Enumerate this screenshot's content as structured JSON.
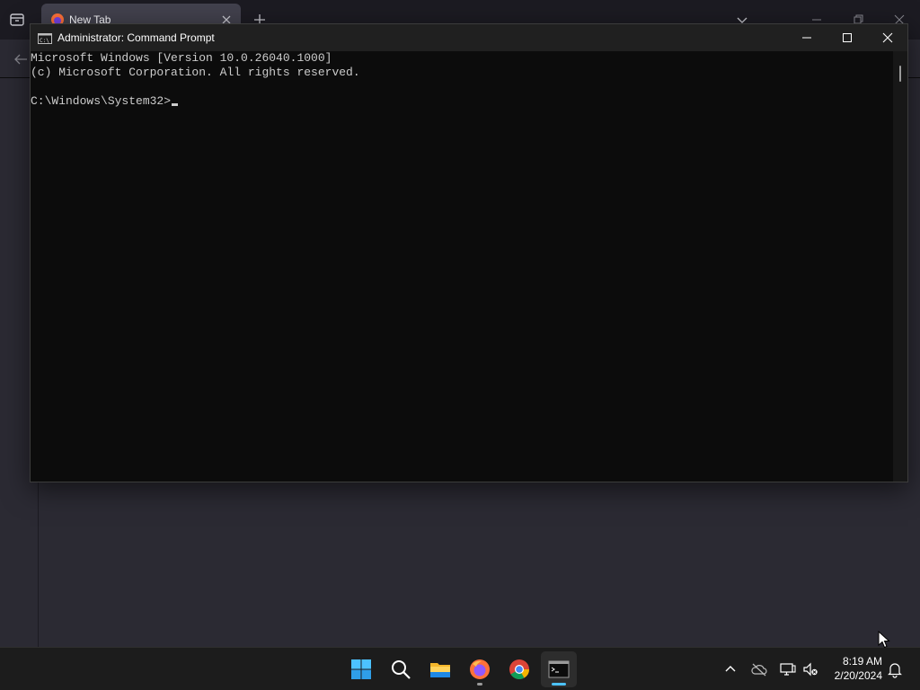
{
  "browser": {
    "tab_title": "New Tab"
  },
  "cmd": {
    "title": "Administrator: Command Prompt",
    "lines": [
      "Microsoft Windows [Version 10.0.26040.1000]",
      "(c) Microsoft Corporation. All rights reserved.",
      "",
      "C:\\Windows\\System32>"
    ]
  },
  "taskbar": {
    "apps": [
      {
        "name": "start",
        "icon": "windows-start-icon"
      },
      {
        "name": "search",
        "icon": "search-icon"
      },
      {
        "name": "file-explorer",
        "icon": "folder-icon"
      },
      {
        "name": "firefox",
        "icon": "firefox-icon"
      },
      {
        "name": "chrome",
        "icon": "chrome-icon"
      },
      {
        "name": "terminal",
        "icon": "terminal-icon"
      }
    ],
    "time": "8:19 AM",
    "date": "2/20/2024"
  },
  "colors": {
    "console_bg": "#0c0c0c",
    "console_text": "#cccccc",
    "accent": "#4cc2ff",
    "browser_bg": "#2b2a33"
  }
}
